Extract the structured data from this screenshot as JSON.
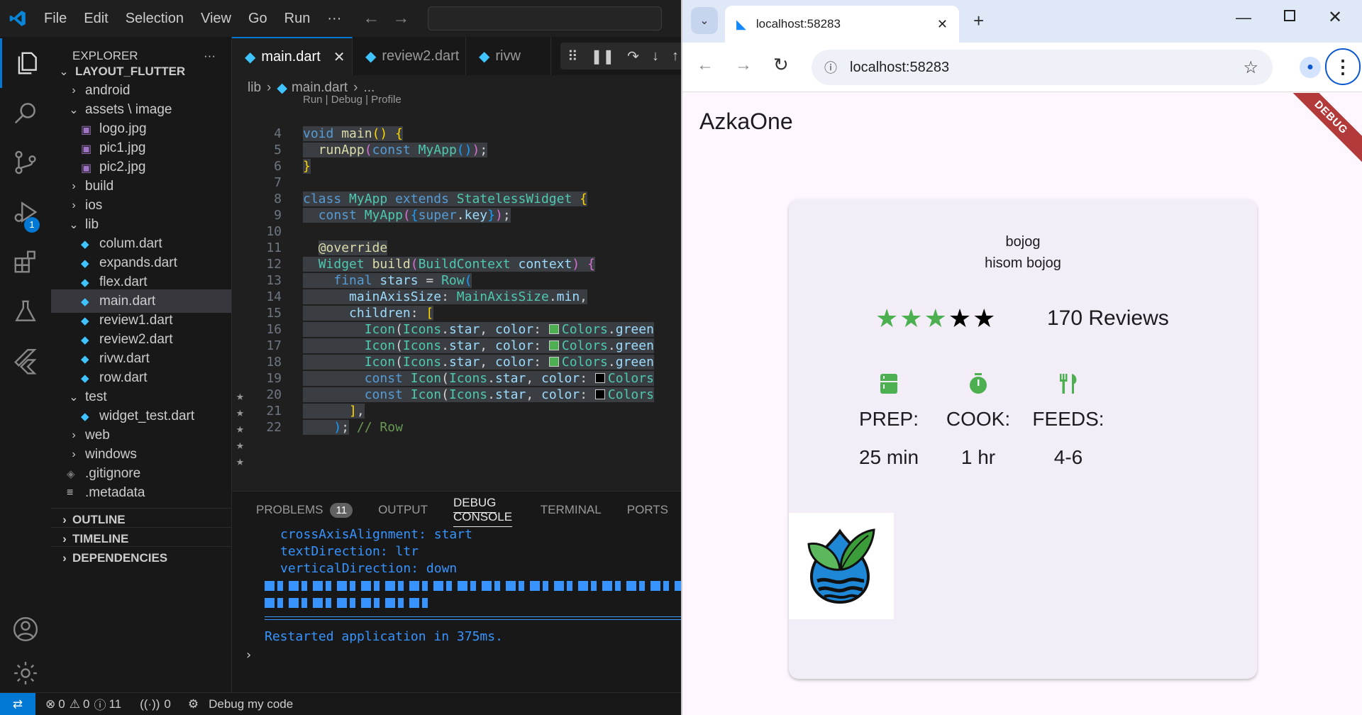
{
  "vscode": {
    "menu": [
      "File",
      "Edit",
      "Selection",
      "View",
      "Go",
      "Run",
      "···"
    ],
    "activity_badge": "1",
    "explorer": {
      "title": "EXPLORER",
      "more": "···",
      "root": "LAYOUT_FLUTTER",
      "tree": [
        {
          "label": "android",
          "kind": "folder",
          "open": false,
          "indent": 1
        },
        {
          "label": "assets \\ image",
          "kind": "folder",
          "open": true,
          "indent": 1
        },
        {
          "label": "logo.jpg",
          "kind": "image",
          "indent": 2
        },
        {
          "label": "pic1.jpg",
          "kind": "image",
          "indent": 2
        },
        {
          "label": "pic2.jpg",
          "kind": "image",
          "indent": 2
        },
        {
          "label": "build",
          "kind": "folder",
          "open": false,
          "indent": 1
        },
        {
          "label": "ios",
          "kind": "folder",
          "open": false,
          "indent": 1
        },
        {
          "label": "lib",
          "kind": "folder",
          "open": true,
          "indent": 1
        },
        {
          "label": "colum.dart",
          "kind": "dart",
          "indent": 2
        },
        {
          "label": "expands.dart",
          "kind": "dart",
          "indent": 2
        },
        {
          "label": "flex.dart",
          "kind": "dart",
          "indent": 2
        },
        {
          "label": "main.dart",
          "kind": "dart",
          "indent": 2,
          "selected": true
        },
        {
          "label": "review1.dart",
          "kind": "dart",
          "indent": 2
        },
        {
          "label": "review2.dart",
          "kind": "dart",
          "indent": 2
        },
        {
          "label": "rivw.dart",
          "kind": "dart",
          "indent": 2
        },
        {
          "label": "row.dart",
          "kind": "dart",
          "indent": 2
        },
        {
          "label": "test",
          "kind": "folder",
          "open": true,
          "indent": 1
        },
        {
          "label": "widget_test.dart",
          "kind": "dart",
          "indent": 2
        },
        {
          "label": "web",
          "kind": "folder",
          "open": false,
          "indent": 1
        },
        {
          "label": "windows",
          "kind": "folder",
          "open": false,
          "indent": 1
        },
        {
          "label": ".gitignore",
          "kind": "git",
          "indent": 1
        },
        {
          "label": ".metadata",
          "kind": "meta",
          "indent": 1
        }
      ],
      "sections": [
        "OUTLINE",
        "TIMELINE",
        "DEPENDENCIES"
      ]
    },
    "tabs": [
      "main.dart",
      "review2.dart",
      "rivw"
    ],
    "breadcrumb": {
      "folder": "lib",
      "file": "main.dart",
      "more": "..."
    },
    "codelens": "Run | Debug | Profile",
    "line_numbers": [
      "4",
      "5",
      "6",
      "7",
      "8",
      "9",
      "10",
      "11",
      "12",
      "13",
      "14",
      "15",
      "16",
      "17",
      "18",
      "19",
      "20",
      "21",
      "22"
    ],
    "panel": {
      "tabs": [
        "PROBLEMS",
        "OUTPUT",
        "DEBUG CONSOLE",
        "TERMINAL",
        "PORTS"
      ],
      "problems_count": "11",
      "console_lines": [
        "crossAxisAlignment: start",
        "textDirection: ltr",
        "verticalDirection: down"
      ],
      "restart_message": "Restarted application in 375ms."
    },
    "status": {
      "errors": "0",
      "warnings": "0",
      "info": "11",
      "ports": "0",
      "debug_label": "Debug my code"
    }
  },
  "browser": {
    "tab_title": "localhost:58283",
    "url": "localhost:58283",
    "app_title": "AzkaOne",
    "debug_banner": "DEBUG",
    "card": {
      "title_line1": "bojog",
      "title_line2": "hisom bojog",
      "rating": 3,
      "rating_max": 5,
      "reviews": "170 Reviews",
      "info": [
        {
          "icon": "kitchen-icon",
          "label": "PREP:",
          "value": "25 min"
        },
        {
          "icon": "timer-icon",
          "label": "COOK:",
          "value": "1 hr"
        },
        {
          "icon": "restaurant-icon",
          "label": "FEEDS:",
          "value": "4-6"
        }
      ]
    },
    "colors": {
      "green": "#4caf50",
      "black": "#000000",
      "card": "#f3edf7",
      "page": "#fef7ff"
    }
  }
}
